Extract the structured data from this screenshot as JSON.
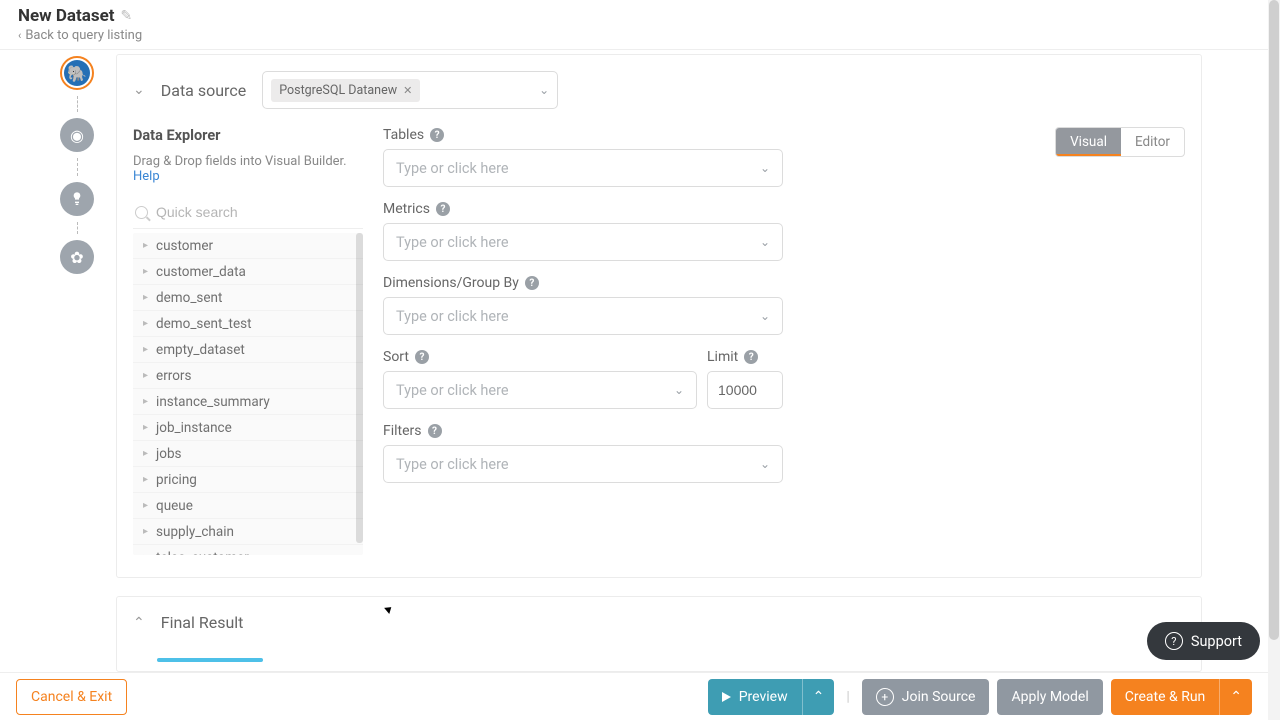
{
  "header": {
    "title": "New Dataset",
    "back": "Back to query listing"
  },
  "datasource": {
    "label": "Data source",
    "tag": "PostgreSQL Datanew"
  },
  "explorer": {
    "title": "Data Explorer",
    "hint_prefix": "Drag & Drop fields into Visual Builder. ",
    "help": "Help",
    "search_placeholder": "Quick search",
    "tables": [
      "customer",
      "customer_data",
      "demo_sent",
      "demo_sent_test",
      "empty_dataset",
      "errors",
      "instance_summary",
      "job_instance",
      "jobs",
      "pricing",
      "queue",
      "supply_chain",
      "telco_customer"
    ]
  },
  "builder": {
    "tables_label": "Tables",
    "metrics_label": "Metrics",
    "dimensions_label": "Dimensions/Group By",
    "sort_label": "Sort",
    "limit_label": "Limit",
    "filters_label": "Filters",
    "placeholder": "Type or click here",
    "limit_value": "10000"
  },
  "tabs": {
    "visual": "Visual",
    "editor": "Editor"
  },
  "final": {
    "label": "Final Result"
  },
  "footer": {
    "cancel": "Cancel & Exit",
    "preview": "Preview",
    "join": "Join Source",
    "apply": "Apply Model",
    "create": "Create & Run"
  },
  "support": "Support"
}
